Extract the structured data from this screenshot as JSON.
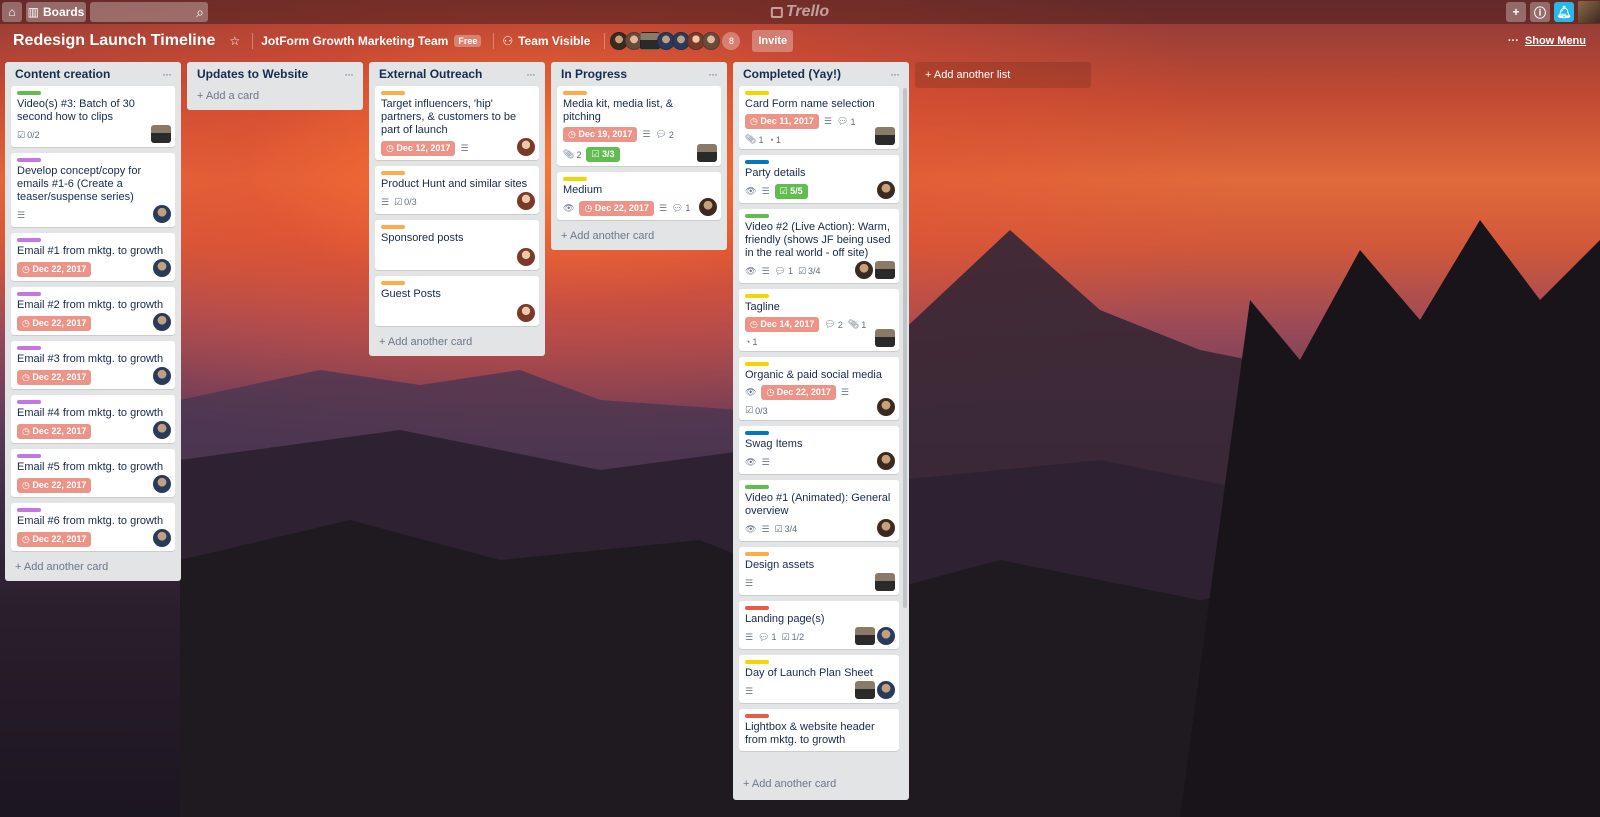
{
  "topbar": {
    "boards_label": "Boards",
    "logo_text": "Trello"
  },
  "header": {
    "title": "Redesign Launch Timeline",
    "team": "JotForm Growth Marketing Team",
    "team_badge": "Free",
    "visibility": "Team Visible",
    "member_count": "8",
    "invite_label": "Invite",
    "show_menu_label": "Show Menu"
  },
  "colors": {
    "green": "#61bd4f",
    "purple": "#c377e0",
    "orange": "#ffab4a",
    "yellow": "#f2d600",
    "blue": "#0079bf",
    "red": "#eb5a46",
    "due": "#ec9488"
  },
  "lists": [
    {
      "title": "Content creation",
      "add_label": "+ Add another card",
      "cards": [
        {
          "label": "green",
          "title": "Video(s) #3: Batch of 30 second how to clips",
          "checklist": "0/2",
          "avatars": [
            "c"
          ]
        },
        {
          "label": "purple",
          "title": "Develop concept/copy for emails #1-6 (Create a teaser/suspense series)",
          "desc": true,
          "avatars": [
            "e"
          ]
        },
        {
          "label": "purple",
          "title": "Email #1 from mktg. to growth",
          "due": "Dec 22, 2017",
          "avatars": [
            "e"
          ]
        },
        {
          "label": "purple",
          "title": "Email #2 from mktg. to growth",
          "due": "Dec 22, 2017",
          "avatars": [
            "e"
          ]
        },
        {
          "label": "purple",
          "title": "Email #3 from mktg. to growth",
          "due": "Dec 22, 2017",
          "avatars": [
            "e"
          ]
        },
        {
          "label": "purple",
          "title": "Email #4 from mktg. to growth",
          "due": "Dec 22, 2017",
          "avatars": [
            "e"
          ]
        },
        {
          "label": "purple",
          "title": "Email #5 from mktg. to growth",
          "due": "Dec 22, 2017",
          "avatars": [
            "e"
          ]
        },
        {
          "label": "purple",
          "title": "Email #6 from mktg. to growth",
          "due": "Dec 22, 2017",
          "avatars": [
            "e"
          ]
        }
      ]
    },
    {
      "title": "Updates to Website",
      "add_label": "+ Add a card",
      "cards": []
    },
    {
      "title": "External Outreach",
      "add_label": "+ Add another card",
      "cards": [
        {
          "label": "orange",
          "title": "Target influencers, 'hip' partners, & customers to be part of launch",
          "due": "Dec 12, 2017",
          "desc": true,
          "avatars": [
            "b"
          ]
        },
        {
          "label": "orange",
          "title": "Product Hunt and similar sites",
          "desc": true,
          "checklist": "0/3",
          "avatars": [
            "b"
          ]
        },
        {
          "label": "orange",
          "title": "Sponsored posts",
          "avatars": [
            "b"
          ]
        },
        {
          "label": "orange",
          "title": "Guest Posts",
          "avatars": [
            "b"
          ]
        }
      ]
    },
    {
      "title": "In Progress",
      "add_label": "+ Add another card",
      "cards": [
        {
          "label": "orange",
          "title": "Media kit, media list, & pitching",
          "due": "Dec 19, 2017",
          "desc": true,
          "comments": "2",
          "attachments": "2",
          "checklist_done": "3/3",
          "avatars": [
            "c"
          ]
        },
        {
          "label": "yellow",
          "title": "Medium",
          "watch": true,
          "due": "Dec 22, 2017",
          "desc": true,
          "comments": "1",
          "avatars": [
            "d"
          ]
        }
      ]
    },
    {
      "title": "Completed (Yay!)",
      "add_label": "+ Add another card",
      "cards": [
        {
          "label": "yellow",
          "title": "Card Form name selection",
          "due": "Dec 11, 2017",
          "desc": true,
          "comments": "1",
          "attachments": "1",
          "votes": "1",
          "avatars": [
            "c"
          ]
        },
        {
          "label": "blue",
          "title": "Party details",
          "watch": true,
          "desc": true,
          "checklist_done": "5/5",
          "avatars": [
            "d"
          ]
        },
        {
          "label": "green",
          "title": "Video #2 (Live Action): Warm, friendly (shows JF being used in the real world - off site)",
          "watch": true,
          "desc": true,
          "comments": "1",
          "checklist": "3/4",
          "avatars": [
            "d",
            "c"
          ]
        },
        {
          "label": "yellow",
          "title": "Tagline",
          "due": "Dec 14, 2017",
          "comments": "2",
          "attachments": "1",
          "votes": "1",
          "avatars": [
            "c"
          ]
        },
        {
          "label": "yellow",
          "title": "Organic & paid social media",
          "watch": true,
          "due": "Dec 22, 2017",
          "desc": true,
          "checklist": "0/3",
          "avatars": [
            "d"
          ]
        },
        {
          "label": "blue",
          "title": "Swag Items",
          "watch": true,
          "desc": true,
          "avatars": [
            "d"
          ]
        },
        {
          "label": "green",
          "title": "Video #1 (Animated): General overview",
          "watch": true,
          "desc": true,
          "checklist": "3/4",
          "avatars": [
            "d"
          ]
        },
        {
          "label": "orange",
          "title": "Design assets",
          "desc": true,
          "avatars": [
            "c"
          ]
        },
        {
          "label": "red",
          "title": "Landing page(s)",
          "desc": true,
          "comments": "1",
          "checklist": "1/2",
          "avatars": [
            "c",
            "e"
          ]
        },
        {
          "label": "yellow",
          "title": "Day of Launch Plan Sheet",
          "desc": true,
          "avatars": [
            "c",
            "e"
          ]
        },
        {
          "label": "red",
          "title": "Lightbox & website header from mktg. to growth"
        }
      ]
    }
  ],
  "add_list_label": "+ Add another list"
}
